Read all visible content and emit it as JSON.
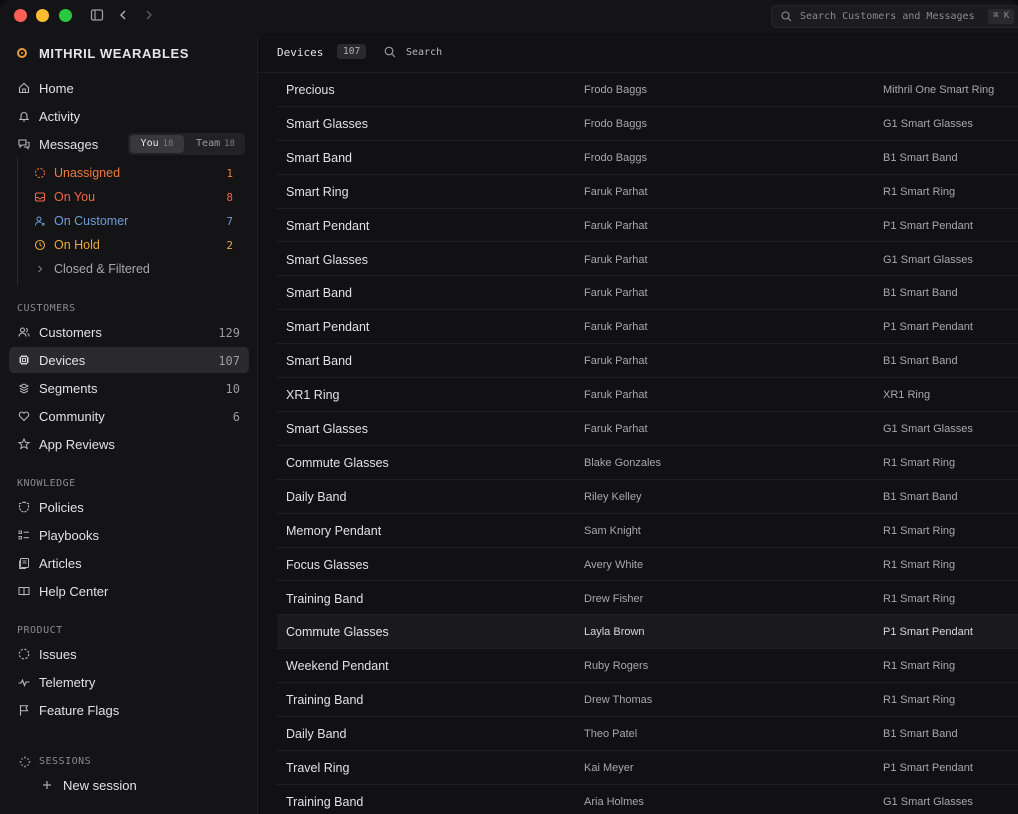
{
  "window": {
    "global_search_placeholder": "Search Customers and Messages",
    "global_search_shortcut": "⌘ K"
  },
  "sidebar": {
    "brand": "MITHRIL WEARABLES",
    "top_items": [
      {
        "label": "Home",
        "icon": "home-icon"
      },
      {
        "label": "Activity",
        "icon": "bell-icon"
      },
      {
        "label": "Messages",
        "icon": "messages-icon"
      }
    ],
    "messages_toggle": {
      "you_label": "You",
      "you_count": "18",
      "team_label": "Team",
      "team_count": "18"
    },
    "message_filters": [
      {
        "label": "Unassigned",
        "count": "1",
        "color": "#f07a3a",
        "icon": "dashed-circle-icon"
      },
      {
        "label": "On You",
        "count": "8",
        "color": "#f0644a",
        "icon": "inbox-icon"
      },
      {
        "label": "On Customer",
        "count": "7",
        "color": "#6f9bd8",
        "icon": "user-wait-icon"
      },
      {
        "label": "On Hold",
        "count": "2",
        "color": "#e8a83c",
        "icon": "clock-icon"
      },
      {
        "label": "Closed & Filtered",
        "count": "",
        "color": "#a0a0a6",
        "icon": "chevron-right-icon"
      }
    ],
    "customers_section": {
      "label": "CUSTOMERS",
      "items": [
        {
          "label": "Customers",
          "count": "129",
          "icon": "users-icon"
        },
        {
          "label": "Devices",
          "count": "107",
          "icon": "chip-icon",
          "active": true
        },
        {
          "label": "Segments",
          "count": "10",
          "icon": "layers-icon"
        },
        {
          "label": "Community",
          "count": "6",
          "icon": "heart-icon"
        },
        {
          "label": "App Reviews",
          "count": "",
          "icon": "star-icon"
        }
      ]
    },
    "knowledge_section": {
      "label": "KNOWLEDGE",
      "items": [
        {
          "label": "Policies",
          "icon": "shield-icon"
        },
        {
          "label": "Playbooks",
          "icon": "checklist-icon"
        },
        {
          "label": "Articles",
          "icon": "article-icon"
        },
        {
          "label": "Help Center",
          "icon": "book-icon"
        }
      ]
    },
    "product_section": {
      "label": "PRODUCT",
      "items": [
        {
          "label": "Issues",
          "icon": "dashed-circle-icon"
        },
        {
          "label": "Telemetry",
          "icon": "pulse-icon"
        },
        {
          "label": "Feature Flags",
          "icon": "flag-icon"
        }
      ]
    },
    "sessions": {
      "label": "SESSIONS",
      "new_session_label": "New session"
    }
  },
  "main": {
    "title": "Devices",
    "count": "107",
    "search_placeholder": "Search",
    "rows": [
      {
        "name": "Precious",
        "customer": "Frodo Baggs",
        "model": "Mithril One Smart Ring"
      },
      {
        "name": "Smart Glasses",
        "customer": "Frodo Baggs",
        "model": "G1 Smart Glasses"
      },
      {
        "name": "Smart Band",
        "customer": "Frodo Baggs",
        "model": "B1 Smart Band"
      },
      {
        "name": "Smart Ring",
        "customer": "Faruk Parhat",
        "model": "R1 Smart Ring"
      },
      {
        "name": "Smart Pendant",
        "customer": "Faruk Parhat",
        "model": "P1 Smart Pendant"
      },
      {
        "name": "Smart Glasses",
        "customer": "Faruk Parhat",
        "model": "G1 Smart Glasses"
      },
      {
        "name": "Smart Band",
        "customer": "Faruk Parhat",
        "model": "B1 Smart Band"
      },
      {
        "name": "Smart Pendant",
        "customer": "Faruk Parhat",
        "model": "P1 Smart Pendant"
      },
      {
        "name": "Smart Band",
        "customer": "Faruk Parhat",
        "model": "B1 Smart Band"
      },
      {
        "name": "XR1 Ring",
        "customer": "Faruk Parhat",
        "model": "XR1 Ring"
      },
      {
        "name": "Smart Glasses",
        "customer": "Faruk Parhat",
        "model": "G1 Smart Glasses"
      },
      {
        "name": "Commute Glasses",
        "customer": "Blake Gonzales",
        "model": "R1 Smart Ring"
      },
      {
        "name": "Daily Band",
        "customer": "Riley Kelley",
        "model": "B1 Smart Band"
      },
      {
        "name": "Memory Pendant",
        "customer": "Sam Knight",
        "model": "R1 Smart Ring"
      },
      {
        "name": "Focus Glasses",
        "customer": "Avery White",
        "model": "R1 Smart Ring"
      },
      {
        "name": "Training Band",
        "customer": "Drew Fisher",
        "model": "R1 Smart Ring"
      },
      {
        "name": "Commute Glasses",
        "customer": "Layla Brown",
        "model": "P1 Smart Pendant",
        "highlighted": true
      },
      {
        "name": "Weekend Pendant",
        "customer": "Ruby Rogers",
        "model": "R1 Smart Ring"
      },
      {
        "name": "Training Band",
        "customer": "Drew Thomas",
        "model": "R1 Smart Ring"
      },
      {
        "name": "Daily Band",
        "customer": "Theo Patel",
        "model": "B1 Smart Band"
      },
      {
        "name": "Travel Ring",
        "customer": "Kai Meyer",
        "model": "P1 Smart Pendant"
      },
      {
        "name": "Training Band",
        "customer": "Aria Holmes",
        "model": "G1 Smart Glasses"
      }
    ]
  }
}
